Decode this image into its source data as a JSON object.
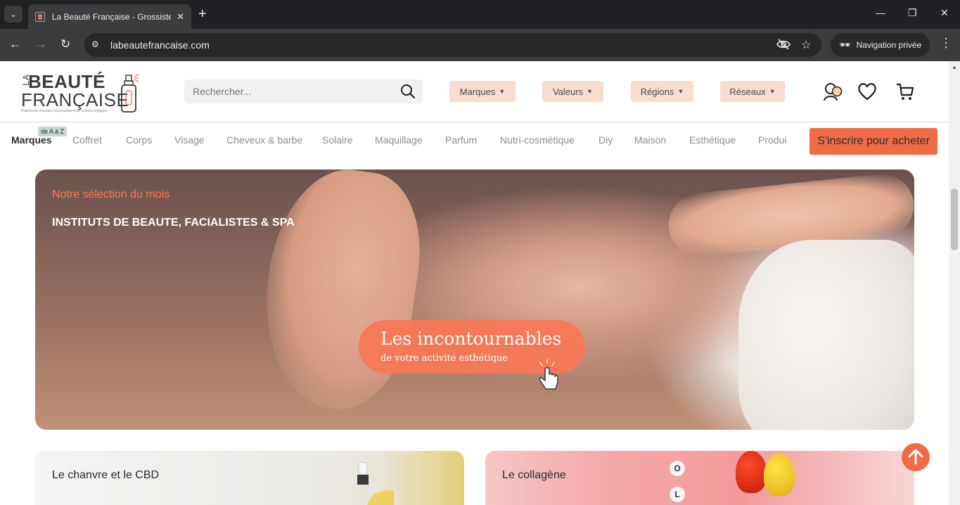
{
  "browser": {
    "tab_title": "La Beauté Française - Grossiste",
    "url": "labeautefrancaise.com",
    "private_label": "Navigation privée"
  },
  "header": {
    "logo": {
      "la": "LA",
      "beaute": "BEAUTÉ",
      "francaise": "FRANÇAISE",
      "tagline": "Plateforme d'achats responsable pour acteurs engagés"
    },
    "search_placeholder": "Rechercher...",
    "dropdowns": [
      "Marques",
      "Valeurs",
      "Régions",
      "Réseaux"
    ]
  },
  "nav": {
    "main": "Marques",
    "badge": "de A à Z",
    "categories": [
      "Coffret",
      "Corps",
      "Visage",
      "Cheveux & barbe",
      "Solaire",
      "Maquillage",
      "Parfum",
      "Nutri-cosmétique",
      "Diy",
      "Maison",
      "Esthétique",
      "Produi"
    ],
    "signup": "S'inscrire pour acheter"
  },
  "hero": {
    "kicker": "Notre sélection du mois",
    "title": "INSTITUTS DE BEAUTE, FACIALISTES & SPA",
    "pill_main": "Les incontournables",
    "pill_sub": "de votre activité esthétique"
  },
  "cards": [
    {
      "title": "Le chanvre et le CBD"
    },
    {
      "title": "Le collagène",
      "beads": [
        "O",
        "L"
      ]
    }
  ],
  "colors": {
    "accent": "#f26b48",
    "dropdown_bg": "#f7dccf",
    "kicker": "#ff7a50"
  }
}
